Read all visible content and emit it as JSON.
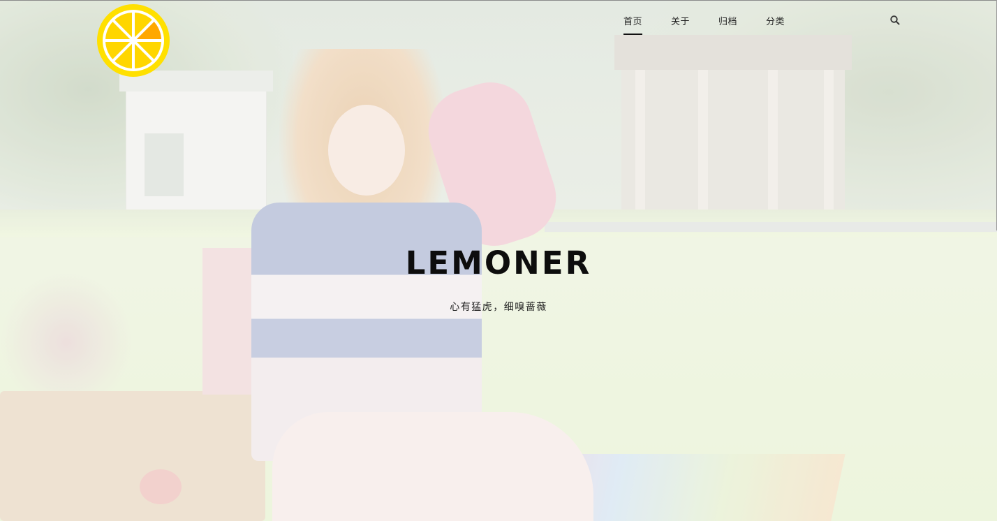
{
  "nav": {
    "items": [
      {
        "label": "首页",
        "active": true
      },
      {
        "label": "关于",
        "active": false
      },
      {
        "label": "归档",
        "active": false
      },
      {
        "label": "分类",
        "active": false
      }
    ]
  },
  "hero": {
    "title": "LEMONER",
    "subtitle": "心有猛虎，细嗅蔷薇"
  },
  "icons": {
    "logo": "lemon-slice-icon",
    "search": "search-icon"
  },
  "colors": {
    "lemon_rim": "#FFE000",
    "lemon_flesh": "#FFD600",
    "lemon_segment_accent": "#FFA800",
    "nav_text": "#222222",
    "title_text": "#0d0d0d"
  }
}
